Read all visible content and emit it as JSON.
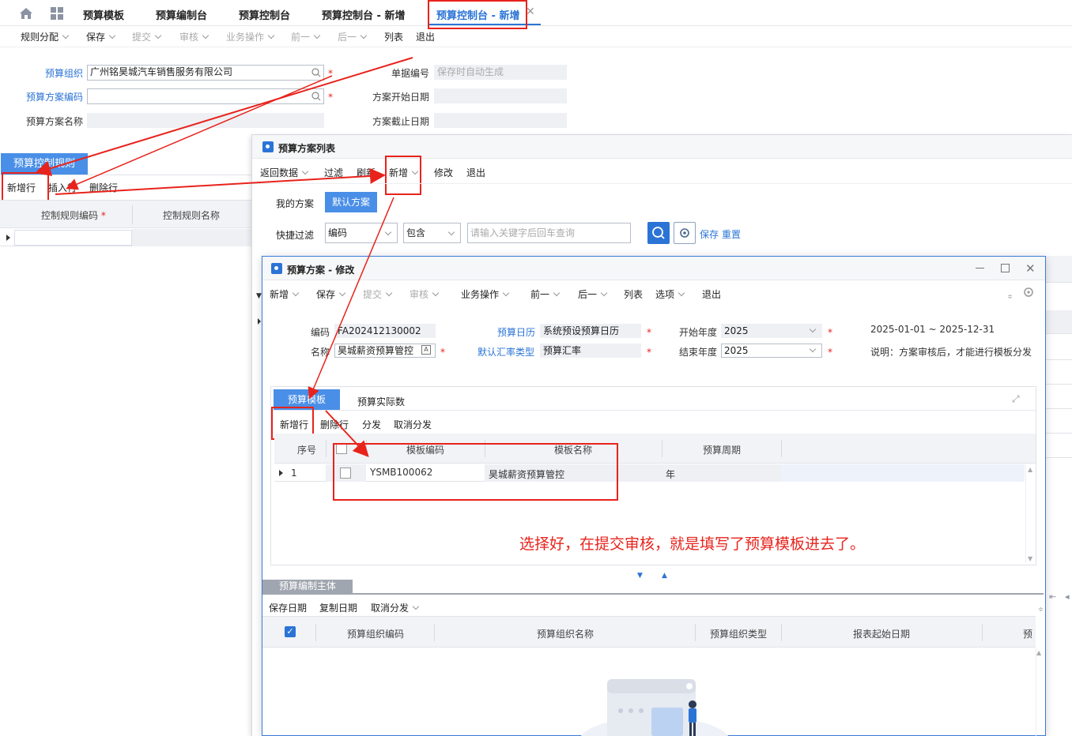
{
  "tabs": [
    "预算模板",
    "预算编制台",
    "预算控制台",
    "预算控制台 - 新增",
    "预算控制台 - 新增"
  ],
  "main_toolbar": {
    "rule_dist": "规则分配",
    "save": "保存",
    "submit": "提交",
    "audit": "审核",
    "biz_op": "业务操作",
    "prev": "前一",
    "next": "后一",
    "list": "列表",
    "exit": "退出"
  },
  "form": {
    "org_label": "预算组织",
    "org_value": "广州铭昊城汽车销售服务有限公司",
    "plan_code_label": "预算方案编码",
    "plan_code_value": "",
    "plan_name_label": "预算方案名称",
    "bill_no_label": "单据编号",
    "bill_no_placeholder": "保存时自动生成",
    "start_date_label": "方案开始日期",
    "end_date_label": "方案截止日期"
  },
  "rules": {
    "tab": "预算控制规则",
    "add_row": "新增行",
    "insert_row": "插入行",
    "delete_row": "删除行",
    "col_code": "控制规则编码",
    "col_name": "控制规则名称"
  },
  "plan_list": {
    "title": "预算方案列表",
    "toolbar": {
      "return": "返回数据",
      "filter": "过滤",
      "refresh": "刷新",
      "add": "新增",
      "modify": "修改",
      "exit": "退出"
    },
    "my_plan": "我的方案",
    "default_plan": "默认方案",
    "quick_filter": "快捷过滤",
    "filter_field": "编码",
    "filter_op": "包含",
    "search_placeholder": "请输入关键字后回车查询",
    "save": "保存",
    "reset": "重置"
  },
  "edit": {
    "title": "预算方案 - 修改",
    "toolbar": {
      "add": "新增",
      "save": "保存",
      "submit": "提交",
      "audit": "审核",
      "biz_op": "业务操作",
      "prev": "前一",
      "next": "后一",
      "list": "列表",
      "options": "选项",
      "exit": "退出"
    },
    "code_label": "编码",
    "code_value": "FA202412130002",
    "name_label": "名称",
    "name_value": "昊城薪资预算管控",
    "calendar_label": "预算日历",
    "calendar_value": "系统预设预算日历",
    "rate_label": "默认汇率类型",
    "rate_value": "预算汇率",
    "start_year_label": "开始年度",
    "start_year_value": "2025",
    "end_year_label": "结束年度",
    "end_year_value": "2025",
    "date_range": "2025-01-01 ~ 2025-12-31",
    "note": "说明：方案审核后，才能进行模板分发",
    "tab_template": "预算模板",
    "tab_actual": "预算实际数",
    "grid_toolbar": {
      "add_row": "新增行",
      "delete_row": "删除行",
      "distribute": "分发",
      "cancel_distribute": "取消分发"
    },
    "grid_cols": {
      "seq": "序号",
      "tpl_code": "模板编码",
      "tpl_name": "模板名称",
      "period": "预算周期"
    },
    "rows": [
      {
        "seq": "1",
        "tpl_code": "YSMB100062",
        "tpl_name": "昊城薪资预算管控",
        "period": "年"
      }
    ],
    "annotation": "选择好，在提交审核，就是填写了预算模板进去了。",
    "sub_tab": "预算编制主体",
    "sub_toolbar": {
      "save_date": "保存日期",
      "copy_date": "复制日期",
      "cancel_distribute": "取消分发"
    },
    "sub_cols": {
      "org_code": "预算组织编码",
      "org_name": "预算组织名称",
      "org_type": "预算组织类型",
      "start_date": "报表起始日期",
      "more": "预"
    }
  }
}
